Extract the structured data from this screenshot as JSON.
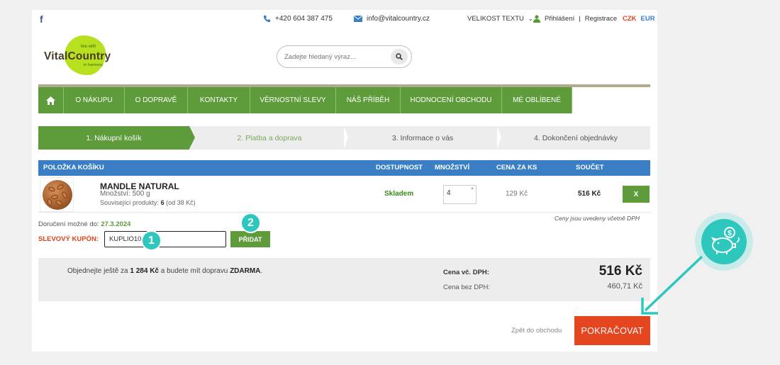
{
  "topbar": {
    "phone": "+420 604 387 475",
    "email": "info@vitalcountry.cz",
    "text_size": "VELIKOST TEXTU",
    "login": "Přihlášení",
    "register": "Registrace",
    "currency_czk": "CZK",
    "currency_eur": "EUR"
  },
  "logo": {
    "name": "VitalCountry",
    "tag1": "live with",
    "tag2": "in harmony"
  },
  "search": {
    "placeholder": "Zadejte hledaný výraz..."
  },
  "nav": {
    "items": [
      {
        "label": "O NÁKUPU"
      },
      {
        "label": "O DOPRAVĚ"
      },
      {
        "label": "KONTAKTY"
      },
      {
        "label": "VĚRNOSTNÍ SLEVY"
      },
      {
        "label": "NÁŠ PŘÍBĚH"
      },
      {
        "label": "HODNOCENÍ OBCHODU"
      },
      {
        "label": "MÉ OBLÍBENÉ"
      }
    ]
  },
  "steps": [
    {
      "label": "1. Nákupní košík"
    },
    {
      "label": "2. Platba a doprava"
    },
    {
      "label": "3. Informace o vás"
    },
    {
      "label": "4. Dokončení objednávky"
    }
  ],
  "table": {
    "headers": {
      "item": "POLOŽKA KOŠÍKU",
      "availability": "DOSTUPNOST",
      "quantity": "MNOŽSTVÍ",
      "unit_price": "CENA ZA KS",
      "total": "SOUČET"
    },
    "row": {
      "name": "MANDLE NATURAL",
      "amount": "Množství: 500 g",
      "related_prefix": "Související produkty:",
      "related_count": "6",
      "related_suffix": "(od 38 Kč)",
      "availability": "Skladem",
      "quantity": "4",
      "unit_price": "129 Kč",
      "total": "516 Kč",
      "remove_label": "X"
    }
  },
  "delivery": {
    "prefix": "Doručení možné do:",
    "date": "27.3.2024"
  },
  "vat_note": "Ceny jsou uvedeny včetně DPH",
  "coupon": {
    "label": "SLEVOVÝ KUPÓN:",
    "value": "KUPLIO10",
    "button": "PŘIDAT"
  },
  "badges": {
    "one": "1",
    "two": "2"
  },
  "summary": {
    "ship_prefix": "Objednejte ještě za",
    "ship_amount": "1 284 Kč",
    "ship_middle": "a budete mít dopravu",
    "ship_free": "ZDARMA",
    "price_vat_label": "Cena vč. DPH:",
    "price_vat": "516 Kč",
    "price_novat_label": "Cena bez DPH:",
    "price_novat": "460,71 Kč"
  },
  "actions": {
    "back": "Zpět do obchodu",
    "continue": "POKRAČOVAT"
  },
  "colors": {
    "green": "#5d9b3b",
    "blue": "#3a7fc6",
    "orange": "#e6461f",
    "teal": "#2dc7be"
  }
}
